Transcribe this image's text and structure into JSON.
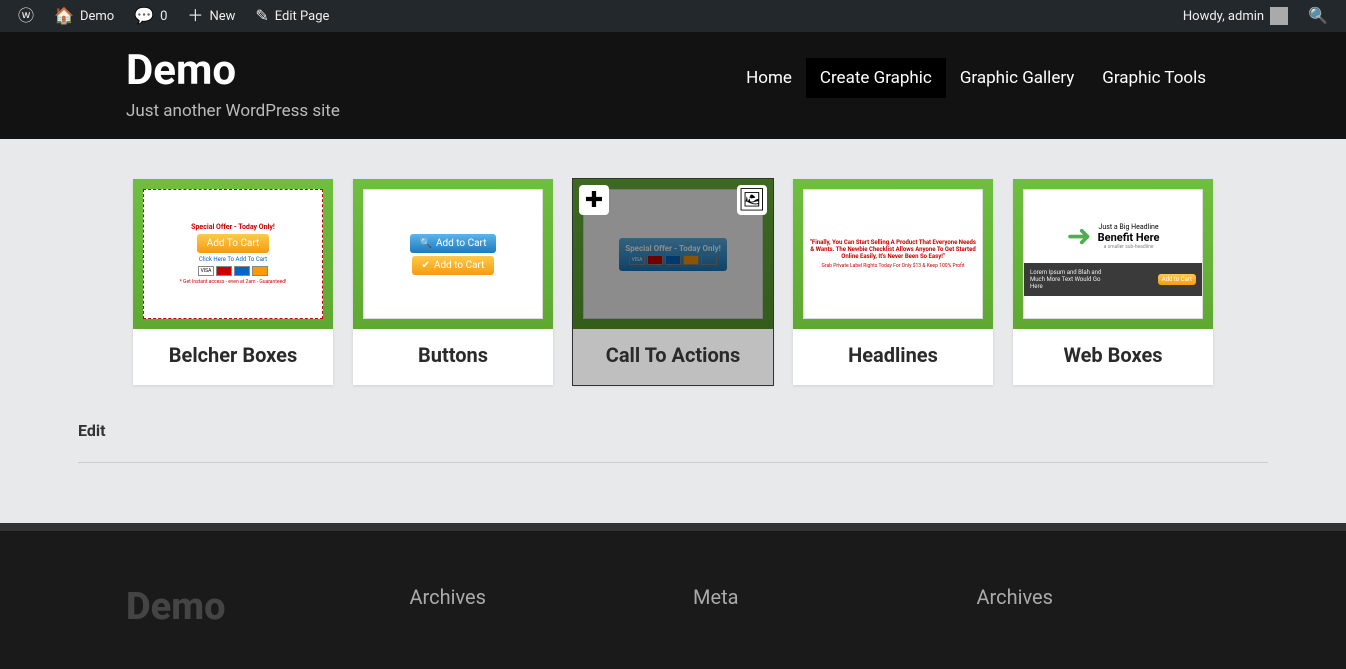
{
  "admin": {
    "site": "Demo",
    "comments": "0",
    "new": "New",
    "edit": "Edit Page",
    "howdy": "Howdy, admin"
  },
  "header": {
    "title": "Demo",
    "desc": "Just another WordPress site",
    "nav": [
      "Home",
      "Create Graphic",
      "Graphic Gallery",
      "Graphic Tools"
    ],
    "active": 1
  },
  "cards": [
    {
      "label": "Belcher Boxes"
    },
    {
      "label": "Buttons"
    },
    {
      "label": "Call To Actions"
    },
    {
      "label": "Headlines"
    },
    {
      "label": "Web Boxes"
    }
  ],
  "mock": {
    "special": "Special Offer - Today Only!",
    "addcart": "Add To Cart",
    "addcart2": "Add to Cart",
    "clickhere": "Click Here To Add To Cart",
    "instant": "* Get Instant access - even at 2am - Guaranteed!",
    "headline_red": "\"Finally, You Can Start Selling A Product That Everyone Needs & Wants. The Newbie Checklist Allows Anyone To Get Started Online Easily, It's Never Been So Easy!\"",
    "headline_sub": "Grab Private Label Rights Today For Only $13 & Keep 100% Profit",
    "wb_title": "Just a Big Headline",
    "wb_benefit": "Benefit Here",
    "wb_sub": "a smaller sub-headline",
    "wb_lorem": "Lorem Ipsum and Blah and Much More Text Would Go Here"
  },
  "edit": "Edit",
  "footer": {
    "brand": "Demo",
    "cols": [
      "Archives",
      "Meta",
      "Archives"
    ]
  }
}
